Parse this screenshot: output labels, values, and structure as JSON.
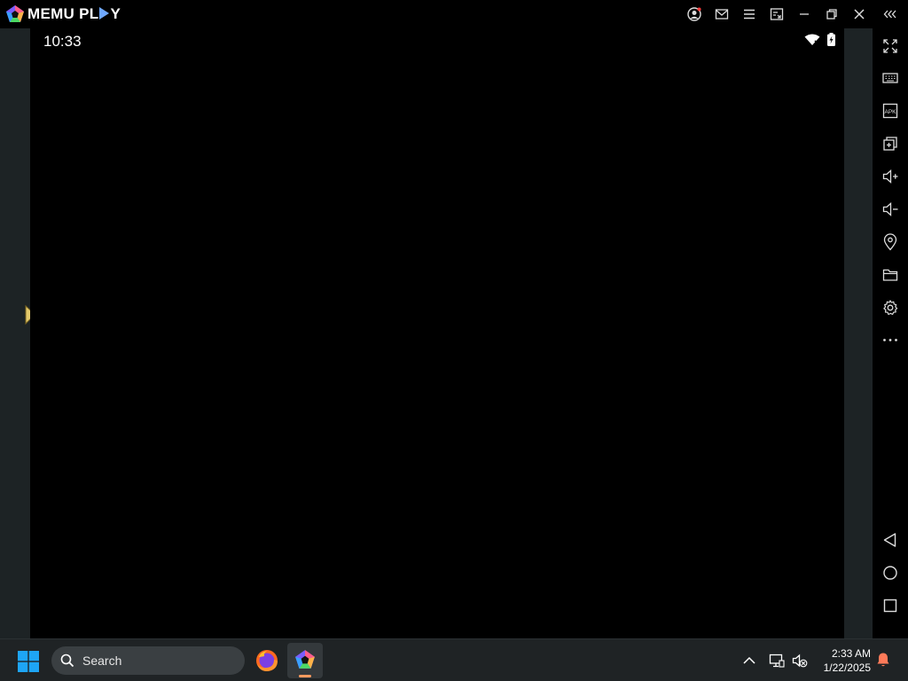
{
  "app": {
    "name": "MEMU PLAY",
    "brand_prefix": "MEMU PL",
    "brand_suffix": "Y"
  },
  "titlebar": {
    "buttons": [
      "account-icon",
      "mail-icon",
      "menu-icon",
      "multi-instance-icon",
      "minimize-icon",
      "restore-icon",
      "close-icon",
      "collapse-sidebar-icon"
    ]
  },
  "android": {
    "status_bar": {
      "time": "10:33",
      "icons": [
        "wifi-icon",
        "battery-charging-icon"
      ]
    }
  },
  "sidebar": {
    "top_items": [
      "fullscreen-icon",
      "keyboard-icon",
      "apk-icon",
      "add-instance-icon",
      "volume-up-icon",
      "volume-down-icon",
      "location-icon",
      "folder-icon",
      "settings-icon",
      "more-icon"
    ],
    "nav_items": [
      "back-icon",
      "home-icon",
      "recents-icon"
    ]
  },
  "taskbar": {
    "search_placeholder": "Search",
    "pinned": [
      "firefox-icon",
      "memu-icon"
    ],
    "tray_icons": [
      "chevron-up-icon",
      "network-icon",
      "volume-muted-icon"
    ],
    "time": "2:33 AM",
    "date": "1/22/2025"
  },
  "colors": {
    "accent_blue": "#6fa8ff",
    "side_gray": "#1d2325",
    "taskbar_bg": "#1f2325",
    "windows_blue": "#1ea5f5",
    "notification_orange": "#ff7a59"
  }
}
